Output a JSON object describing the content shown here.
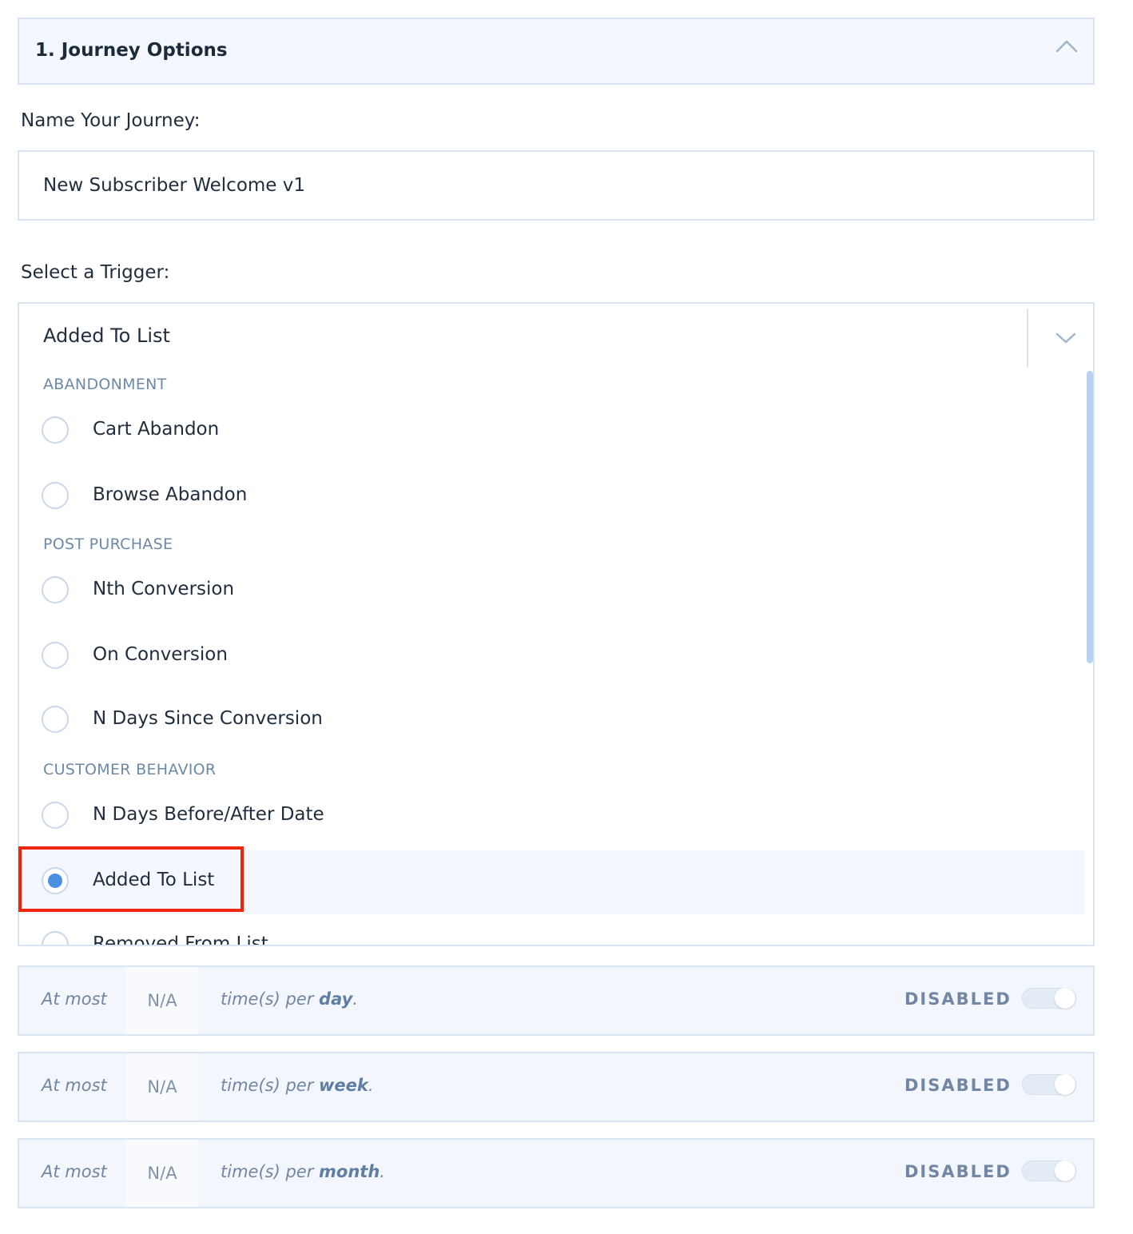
{
  "section": {
    "title": "1. Journey Options"
  },
  "name_field": {
    "label": "Name Your Journey:",
    "value": "New Subscriber Welcome v1"
  },
  "trigger": {
    "label": "Select a Trigger:",
    "selected": "Added To List",
    "groups": [
      {
        "label": "ABANDONMENT",
        "options": [
          "Cart Abandon",
          "Browse Abandon"
        ]
      },
      {
        "label": "POST PURCHASE",
        "options": [
          "Nth Conversion",
          "On Conversion",
          "N Days Since Conversion"
        ]
      },
      {
        "label": "CUSTOMER BEHAVIOR",
        "options": [
          "N Days Before/After Date",
          "Added To List",
          "Removed From List"
        ]
      }
    ]
  },
  "limits": [
    {
      "prefix": "At most",
      "value": "N/A",
      "suffix": "time(s) per",
      "period": "day",
      "status": "DISABLED"
    },
    {
      "prefix": "At most",
      "value": "N/A",
      "suffix": "time(s) per",
      "period": "week",
      "status": "DISABLED"
    },
    {
      "prefix": "At most",
      "value": "N/A",
      "suffix": "time(s) per",
      "period": "month",
      "status": "DISABLED"
    }
  ],
  "colors": {
    "accent": "#4a90e2",
    "highlight_border": "#f0260a",
    "panel_bg": "#f4f7fd",
    "border": "#d8e4f2"
  }
}
